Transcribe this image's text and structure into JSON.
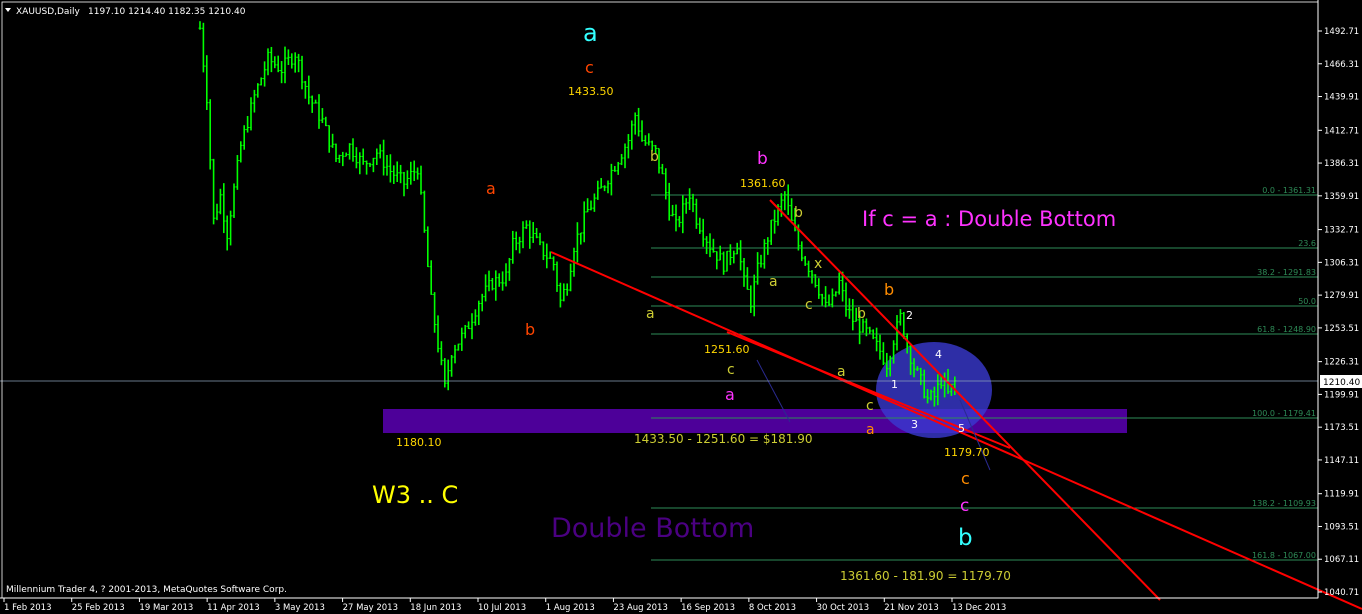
{
  "header": {
    "symbol": "XAUUSD,Daily",
    "ohlc": "1197.10 1214.40 1182.35 1210.40"
  },
  "footer": {
    "copyright": "Millennium Trader 4, ? 2001-2013, MetaQuotes Software Corp."
  },
  "colors": {
    "background": "#000000",
    "candle": "#00ff00",
    "trendline": "#ff0000",
    "fibo": "#2e8b57",
    "zone": "#5a00b4",
    "axis": "#ffffff",
    "cyan": "#33ffff",
    "magenta": "#ff33ff",
    "orange": "#ff4500",
    "olive": "#cccc33",
    "gold": "#ffd700",
    "title_purple": "#4b0082"
  },
  "chart_data": {
    "type": "candlestick",
    "ylim": [
      1040.71,
      1505
    ],
    "price_ticks": [
      "1492.71",
      "1466.31",
      "1439.91",
      "1412.71",
      "1386.31",
      "1359.91",
      "1332.71",
      "1306.31",
      "1279.91",
      "1253.51",
      "1226.31",
      "1199.91",
      "1173.51",
      "1147.11",
      "1119.91",
      "1093.51",
      "1067.11",
      "1040.71"
    ],
    "current_price": "1210.40",
    "date_ticks": [
      "1 Feb 2013",
      "25 Feb 2013",
      "19 Mar 2013",
      "11 Apr 2013",
      "3 May 2013",
      "27 May 2013",
      "18 Jun 2013",
      "10 Jul 2013",
      "1 Aug 2013",
      "23 Aug 2013",
      "16 Sep 2013",
      "8 Oct 2013",
      "30 Oct 2013",
      "21 Nov 2013",
      "13 Dec 2013"
    ],
    "close_path": [
      [
        0,
        1495
      ],
      [
        2,
        1440
      ],
      [
        4,
        1340
      ],
      [
        6,
        1360
      ],
      [
        8,
        1330
      ],
      [
        12,
        1400
      ],
      [
        16,
        1440
      ],
      [
        20,
        1470
      ],
      [
        24,
        1462
      ],
      [
        28,
        1475
      ],
      [
        32,
        1440
      ],
      [
        36,
        1420
      ],
      [
        40,
        1390
      ],
      [
        44,
        1400
      ],
      [
        48,
        1385
      ],
      [
        52,
        1395
      ],
      [
        56,
        1380
      ],
      [
        60,
        1370
      ],
      [
        64,
        1383
      ],
      [
        66,
        1330
      ],
      [
        68,
        1275
      ],
      [
        70,
        1240
      ],
      [
        72,
        1205
      ],
      [
        74,
        1235
      ],
      [
        78,
        1250
      ],
      [
        82,
        1275
      ],
      [
        86,
        1290
      ],
      [
        90,
        1295
      ],
      [
        92,
        1320
      ],
      [
        96,
        1335
      ],
      [
        100,
        1318
      ],
      [
        104,
        1305
      ],
      [
        106,
        1275
      ],
      [
        108,
        1290
      ],
      [
        110,
        1320
      ],
      [
        114,
        1348
      ],
      [
        118,
        1365
      ],
      [
        122,
        1385
      ],
      [
        126,
        1405
      ],
      [
        128,
        1425
      ],
      [
        130,
        1405
      ],
      [
        134,
        1395
      ],
      [
        136,
        1375
      ],
      [
        138,
        1350
      ],
      [
        140,
        1335
      ],
      [
        144,
        1362
      ],
      [
        146,
        1342
      ],
      [
        150,
        1320
      ],
      [
        154,
        1305
      ],
      [
        158,
        1322
      ],
      [
        160,
        1290
      ],
      [
        162,
        1275
      ],
      [
        164,
        1300
      ],
      [
        166,
        1318
      ],
      [
        168,
        1335
      ],
      [
        170,
        1348
      ],
      [
        172,
        1360
      ],
      [
        174,
        1338
      ],
      [
        176,
        1320
      ],
      [
        178,
        1308
      ],
      [
        180,
        1298
      ],
      [
        182,
        1285
      ],
      [
        184,
        1270
      ],
      [
        186,
        1275
      ],
      [
        188,
        1290
      ],
      [
        190,
        1270
      ],
      [
        192,
        1260
      ],
      [
        194,
        1255
      ],
      [
        196,
        1250
      ],
      [
        198,
        1242
      ],
      [
        200,
        1235
      ],
      [
        202,
        1225
      ],
      [
        204,
        1245
      ],
      [
        206,
        1262
      ],
      [
        208,
        1240
      ],
      [
        210,
        1222
      ],
      [
        212,
        1210
      ],
      [
        214,
        1196
      ],
      [
        216,
        1198
      ],
      [
        218,
        1212
      ],
      [
        220,
        1200
      ],
      [
        222,
        1210
      ]
    ],
    "labels": [
      {
        "text": "1433.50"
      },
      {
        "text": "1361.60"
      },
      {
        "text": "1251.60"
      },
      {
        "text": "1180.10"
      },
      {
        "text": "1179.70"
      },
      {
        "text": "1433.50 - 1251.60 = $181.90"
      },
      {
        "text": "1361.60 -  181.90  =  1179.70"
      }
    ],
    "fibo_levels": [
      "0.0 - 1361.31",
      "23.6",
      "38.2 - 1291.83",
      "50.0",
      "61.8 - 1248.90",
      "100.0 - 1179.41",
      "138.2 - 1109.93",
      "161.8 - 1067.00"
    ],
    "annotations": {
      "if_text": "If   c = a :  Double Bottom",
      "db_text": "Double Bottom",
      "w3_text": "W3 .. C",
      "waves": [
        "a",
        "c",
        "b",
        "a",
        "b",
        "c",
        "a",
        "b",
        "b",
        "x",
        "a",
        "c",
        "a",
        "b",
        "a",
        "c",
        "b",
        "a",
        "b",
        "c",
        "c",
        "c",
        "b",
        "1",
        "2",
        "3",
        "4",
        "5"
      ]
    }
  }
}
